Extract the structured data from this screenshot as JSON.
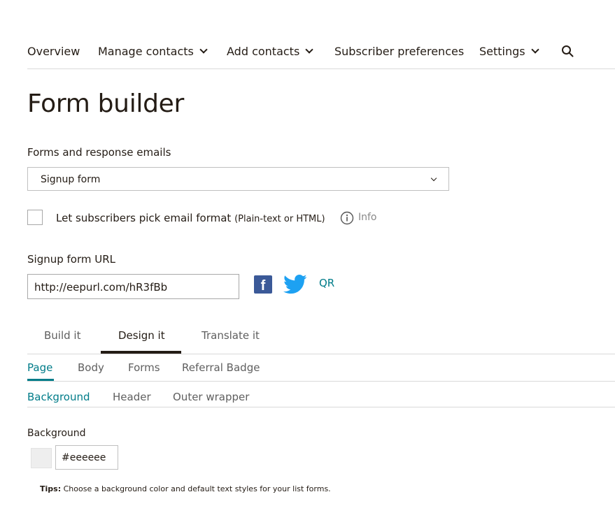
{
  "nav": {
    "overview": "Overview",
    "manage_contacts": "Manage contacts",
    "add_contacts": "Add contacts",
    "subscriber_preferences": "Subscriber preferences",
    "settings": "Settings"
  },
  "page": {
    "title": "Form builder"
  },
  "forms_section": {
    "label": "Forms and response emails",
    "selected_form": "Signup form"
  },
  "email_format": {
    "label": "Let subscribers pick email format",
    "sublabel": "(Plain-text or HTML)",
    "checked": false,
    "info_label": "Info"
  },
  "signup_url": {
    "label": "Signup form URL",
    "value": "http://eepurl.com/hR3fBb",
    "qr_label": "QR"
  },
  "tabs": [
    "Build it",
    "Design it",
    "Translate it"
  ],
  "active_tab": "Design it",
  "design_tabs": [
    "Page",
    "Body",
    "Forms",
    "Referral Badge"
  ],
  "active_design_tab": "Page",
  "page_sections": [
    "Background",
    "Header",
    "Outer wrapper"
  ],
  "active_page_section": "Background",
  "background": {
    "label": "Background",
    "color_value": "#eeeeee"
  },
  "tips": {
    "prefix": "Tips:",
    "text": " Choose a background color and default text styles for your list forms."
  },
  "colors": {
    "accent": "#007c89",
    "text": "#241c15",
    "facebook": "#3b5998",
    "twitter": "#1da1f2"
  },
  "icons": [
    "chevron-down-icon",
    "search-icon",
    "info-icon",
    "facebook-icon",
    "twitter-icon"
  ]
}
